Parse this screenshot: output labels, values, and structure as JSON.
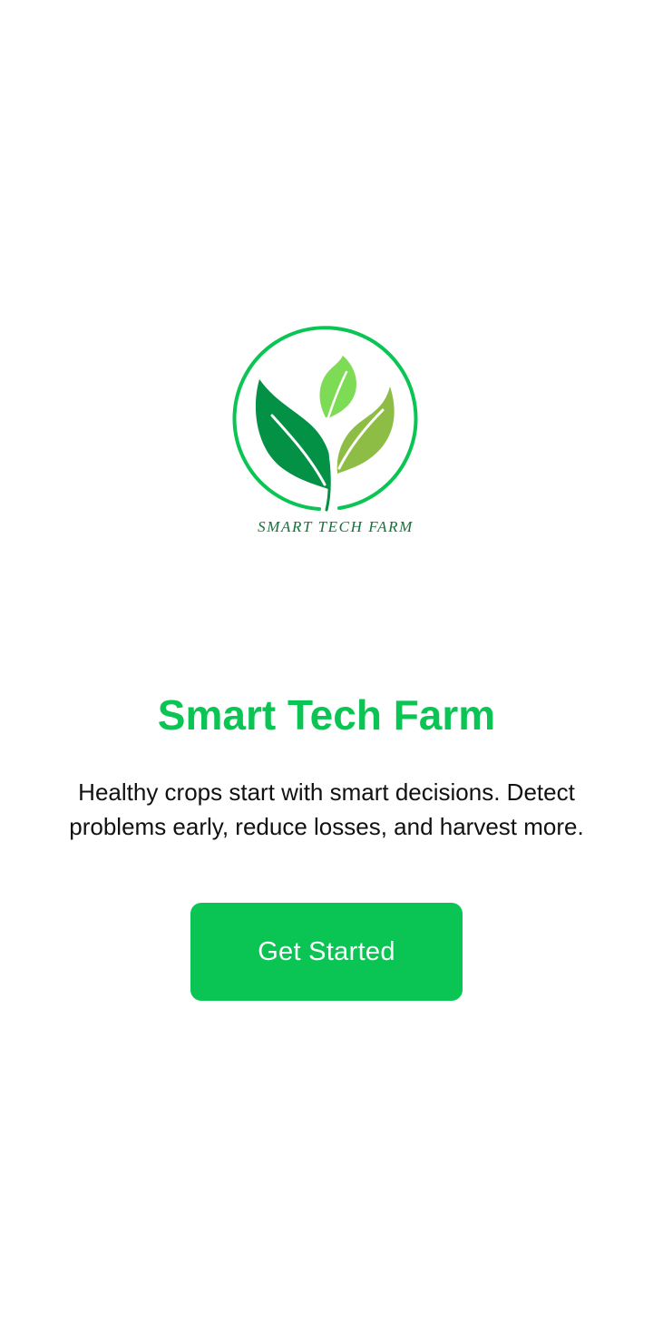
{
  "logo": {
    "wordmark": "SMART TECH FARM",
    "icon": "leaf-sprout-logo"
  },
  "title": "Smart Tech Farm",
  "tagline": "Healthy crops start with smart decisions. Detect problems early, reduce losses, and harvest more.",
  "cta": {
    "label": "Get Started"
  },
  "colors": {
    "accent": "#0ac554",
    "ring": "#0ac554",
    "leaf_dark": "#039146",
    "leaf_light": "#7ddb55",
    "leaf_mid": "#8dbd45",
    "wordmark": "#16703a",
    "background": "#ffffff",
    "text": "#111111"
  }
}
